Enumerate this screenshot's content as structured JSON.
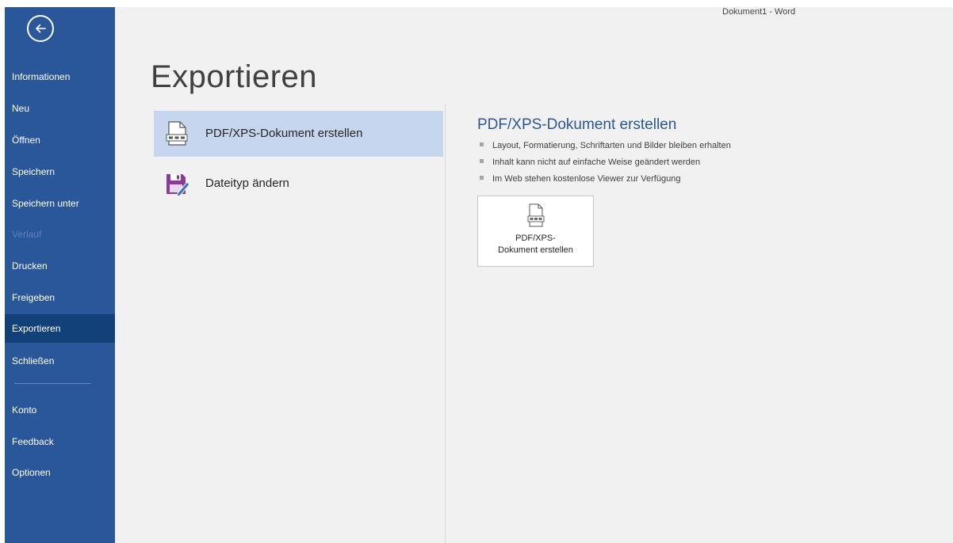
{
  "window": {
    "title": "Dokument1  -  Word"
  },
  "sidebar": {
    "items": [
      {
        "label": "Informationen",
        "state": "normal"
      },
      {
        "label": "Neu",
        "state": "normal"
      },
      {
        "label": "Öffnen",
        "state": "normal"
      },
      {
        "label": "Speichern",
        "state": "normal"
      },
      {
        "label": "Speichern unter",
        "state": "normal"
      },
      {
        "label": "Verlauf",
        "state": "disabled"
      },
      {
        "label": "Drucken",
        "state": "normal"
      },
      {
        "label": "Freigeben",
        "state": "normal"
      },
      {
        "label": "Exportieren",
        "state": "selected"
      },
      {
        "label": "Schließen",
        "state": "normal"
      },
      {
        "label": "Konto",
        "state": "normal"
      },
      {
        "label": "Feedback",
        "state": "normal"
      },
      {
        "label": "Optionen",
        "state": "normal"
      }
    ]
  },
  "main": {
    "title": "Exportieren",
    "options": [
      {
        "label": "PDF/XPS-Dokument erstellen",
        "icon": "pdf-document-icon",
        "selected": true
      },
      {
        "label": "Dateityp ändern",
        "icon": "save-as-icon",
        "selected": false
      }
    ]
  },
  "detail": {
    "heading": "PDF/XPS-Dokument erstellen",
    "bullets": [
      "Layout, Formatierung, Schriftarten und Bilder bleiben erhalten",
      "Inhalt kann nicht auf einfache Weise geändert werden",
      "Im Web stehen kostenlose Viewer zur Verfügung"
    ],
    "button": {
      "line1": "PDF/XPS-",
      "line2": "Dokument erstellen",
      "icon": "pdf-document-icon"
    }
  },
  "colors": {
    "sidebar_bg": "#2a579a",
    "sidebar_selected": "#124078",
    "option_selected": "#c5d6ee",
    "heading_accent": "#2b579a",
    "save_icon_purple": "#8b3a9a"
  }
}
